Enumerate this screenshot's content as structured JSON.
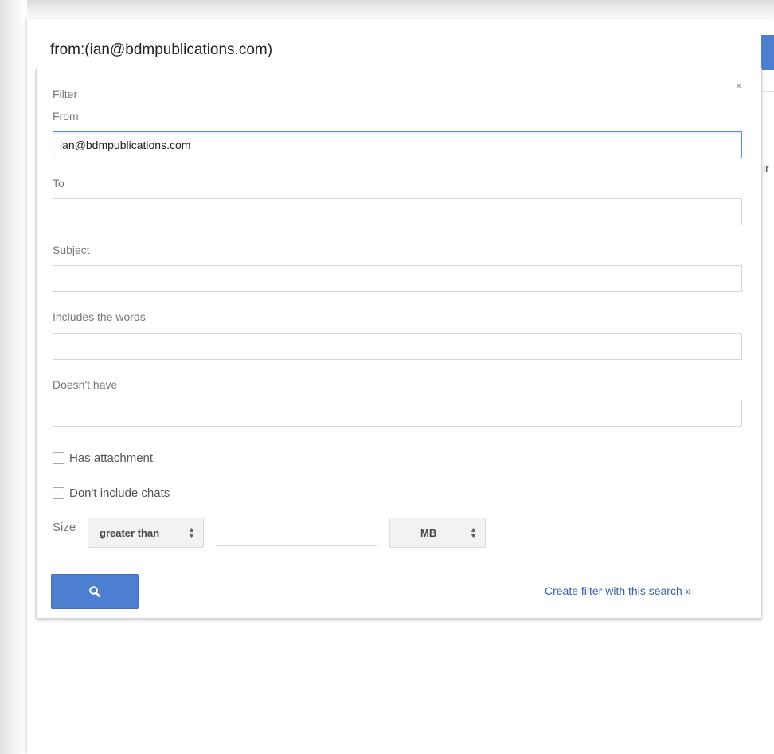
{
  "search": {
    "query": "from:(ian@bdmpublications.com)"
  },
  "background": {
    "partial_text": "ir"
  },
  "filter": {
    "heading": "Filter",
    "close_symbol": "×",
    "from": {
      "label": "From",
      "value": "ian@bdmpublications.com"
    },
    "to": {
      "label": "To",
      "value": ""
    },
    "subject": {
      "label": "Subject",
      "value": ""
    },
    "includes": {
      "label": "Includes the words",
      "value": ""
    },
    "doesnt_have": {
      "label": "Doesn't have",
      "value": ""
    },
    "has_attachment": {
      "label": "Has attachment",
      "checked": false
    },
    "dont_include_chats": {
      "label": "Don't include chats",
      "checked": false
    },
    "size": {
      "label": "Size",
      "comparator": "greater than",
      "value": "",
      "unit": "MB"
    },
    "search_button_icon": "search-icon",
    "create_filter_link": "Create filter with this search »"
  },
  "colors": {
    "accent": "#4d7fd0",
    "link": "#3a5fa8",
    "focus_border": "#4d90fe"
  }
}
